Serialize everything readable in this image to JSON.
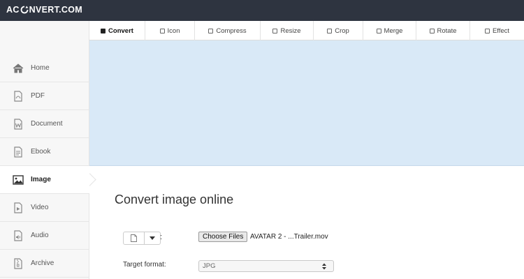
{
  "brand": {
    "logo_prefix": "AC",
    "logo_suffix": "NVERT.COM"
  },
  "sidebar": {
    "items": [
      {
        "label": "Home",
        "icon": "home-icon"
      },
      {
        "label": "PDF",
        "icon": "pdf-icon"
      },
      {
        "label": "Document",
        "icon": "document-icon"
      },
      {
        "label": "Ebook",
        "icon": "ebook-icon"
      },
      {
        "label": "Image",
        "icon": "image-icon",
        "active": true
      },
      {
        "label": "Video",
        "icon": "video-icon"
      },
      {
        "label": "Audio",
        "icon": "audio-icon"
      },
      {
        "label": "Archive",
        "icon": "archive-icon"
      }
    ]
  },
  "tabs": [
    {
      "label": "Convert",
      "active": true
    },
    {
      "label": "Icon"
    },
    {
      "label": "Compress"
    },
    {
      "label": "Resize"
    },
    {
      "label": "Crop"
    },
    {
      "label": "Merge"
    },
    {
      "label": "Rotate"
    },
    {
      "label": "Effect"
    }
  ],
  "main": {
    "title": "Convert image online",
    "colon": ":",
    "choose_files_label": "Choose Files",
    "selected_file": "AVATAR 2 - ...Trailer.mov",
    "target_format_label": "Target format:",
    "target_format_value": "JPG"
  },
  "colors": {
    "topbar": "#2e3440",
    "banner": "#d9e9f7",
    "sidebar": "#f7f7f7"
  }
}
